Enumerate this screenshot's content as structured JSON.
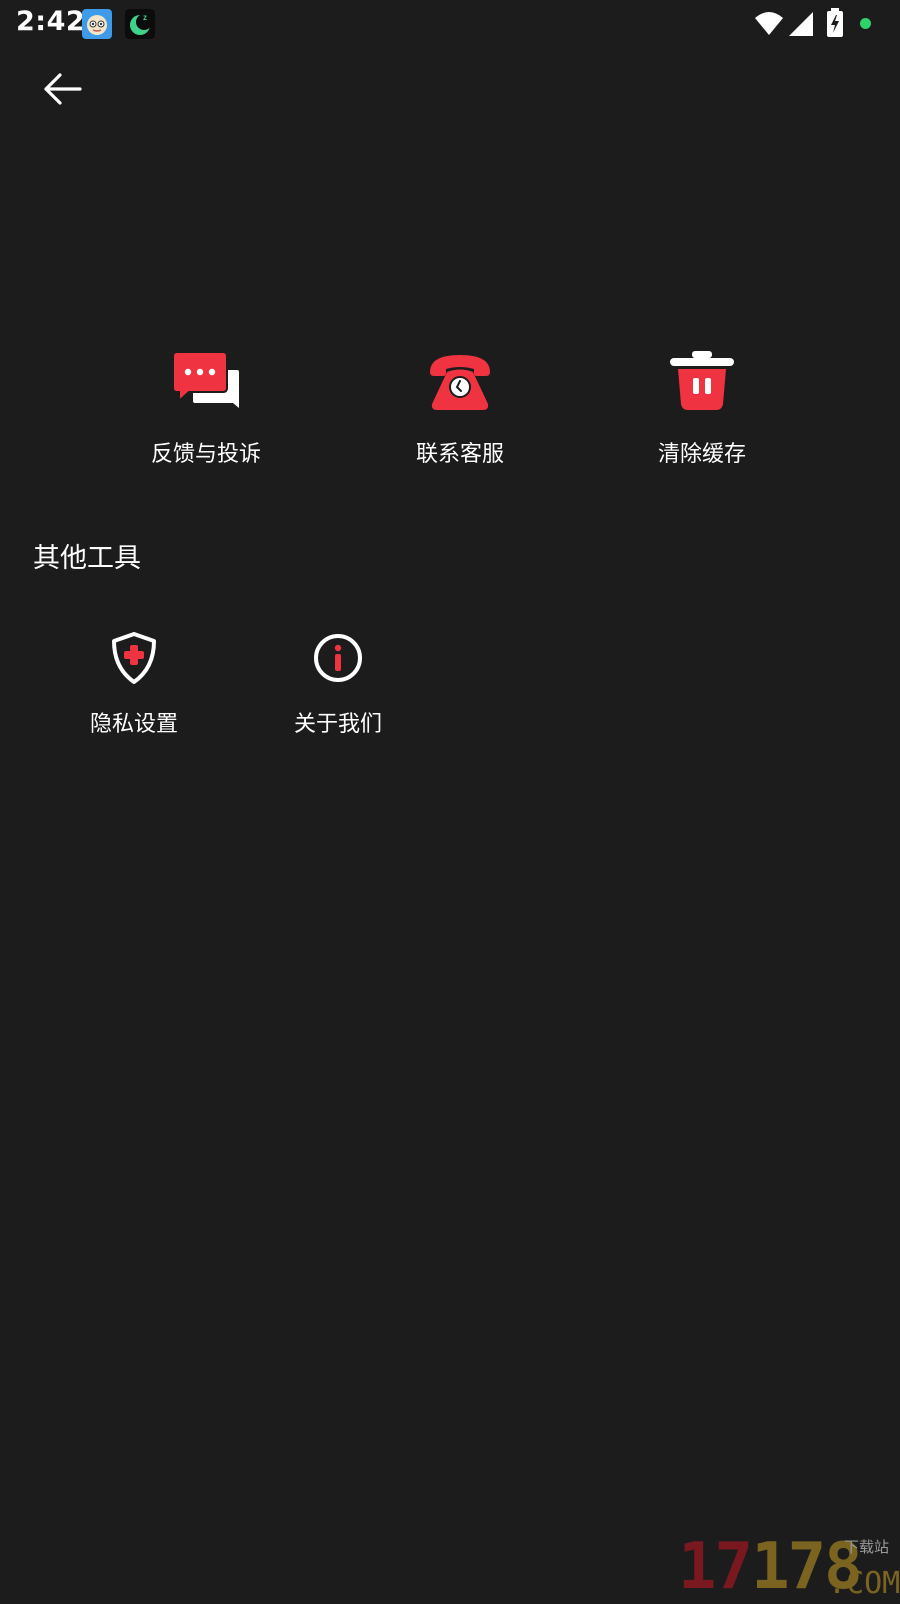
{
  "status_bar": {
    "time": "2:42",
    "indicator_color": "#2fd36a"
  },
  "header": {
    "back_icon": "arrow-left-icon"
  },
  "accent_color": "#f03340",
  "main_tools": [
    {
      "label": "反馈与投诉",
      "icon": "feedback-chat-icon"
    },
    {
      "label": "联系客服",
      "icon": "telephone-icon"
    },
    {
      "label": "清除缓存",
      "icon": "trash-icon"
    }
  ],
  "other_tools": {
    "title": "其他工具",
    "items": [
      {
        "label": "隐私设置",
        "icon": "shield-plus-icon"
      },
      {
        "label": "关于我们",
        "icon": "info-icon"
      }
    ]
  },
  "watermark": {
    "digits_a": "17",
    "digits_b": "178",
    "tag": "下载站",
    "suffix": ".COM"
  }
}
